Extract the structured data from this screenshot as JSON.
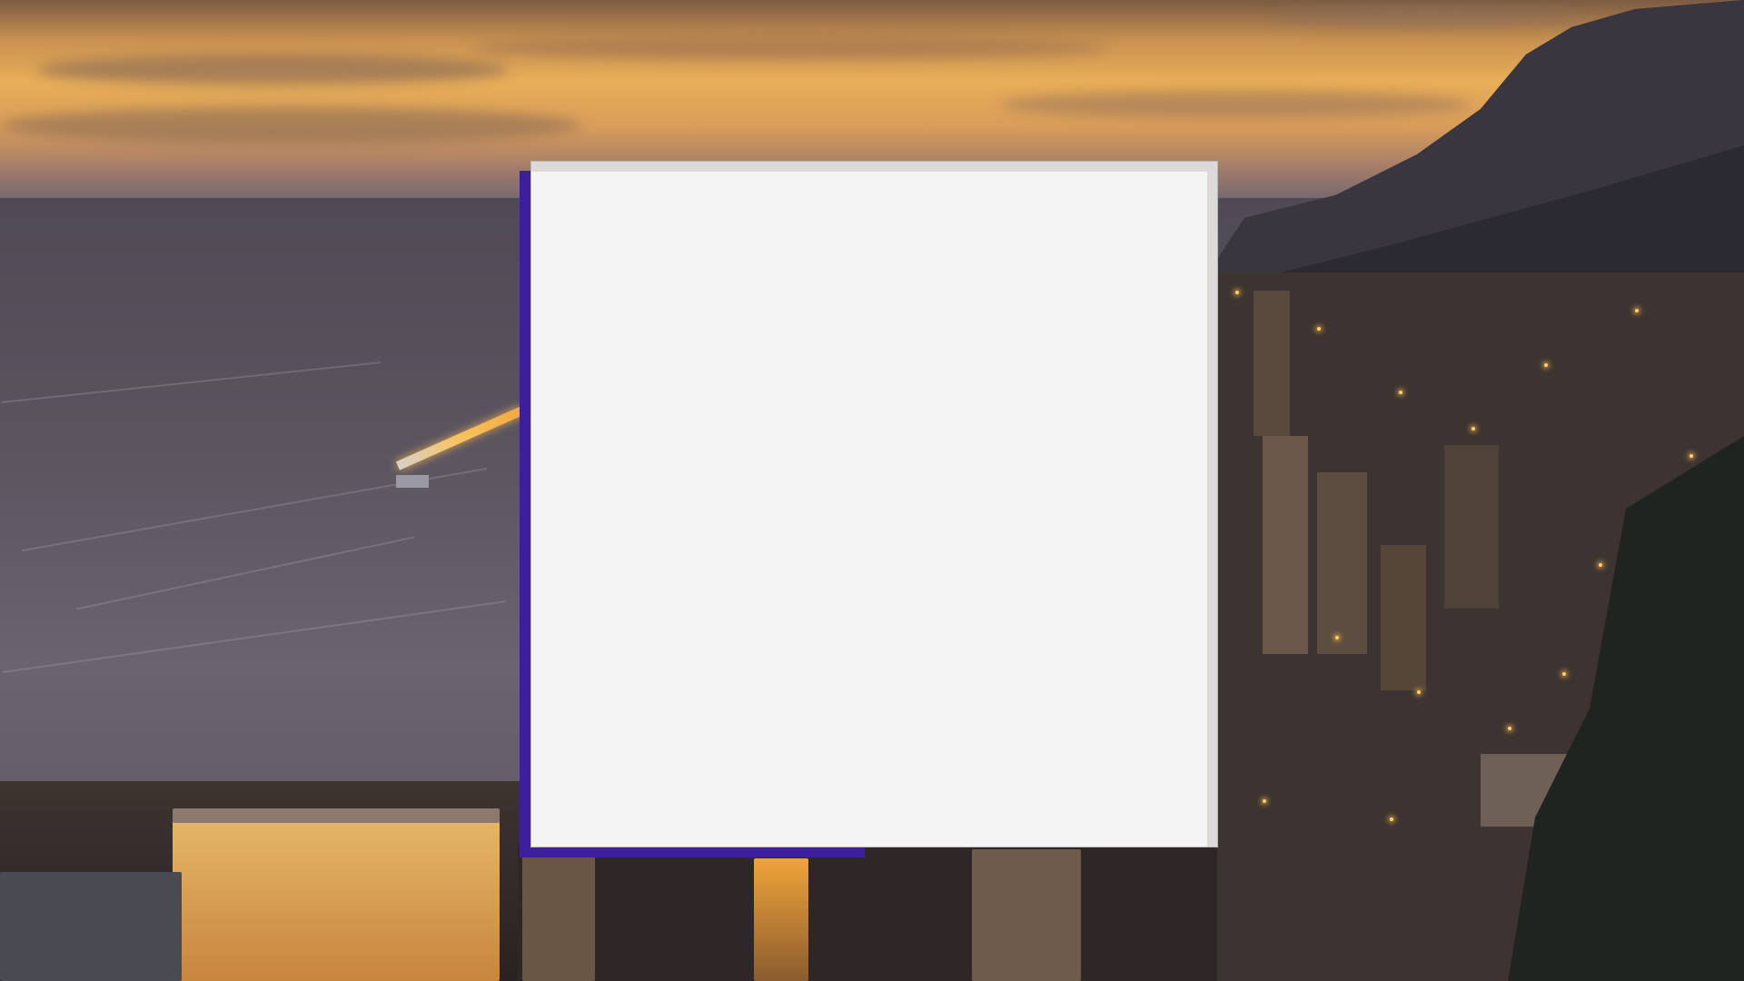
{
  "screen": {
    "description_visible_text": ""
  },
  "desktop": {
    "wallpaper_icon": "city-coast-sunset-photo"
  },
  "dialog": {
    "title": "",
    "content": "",
    "accent_color": "#3d1e9c",
    "body_color": "#f4f4f4"
  }
}
